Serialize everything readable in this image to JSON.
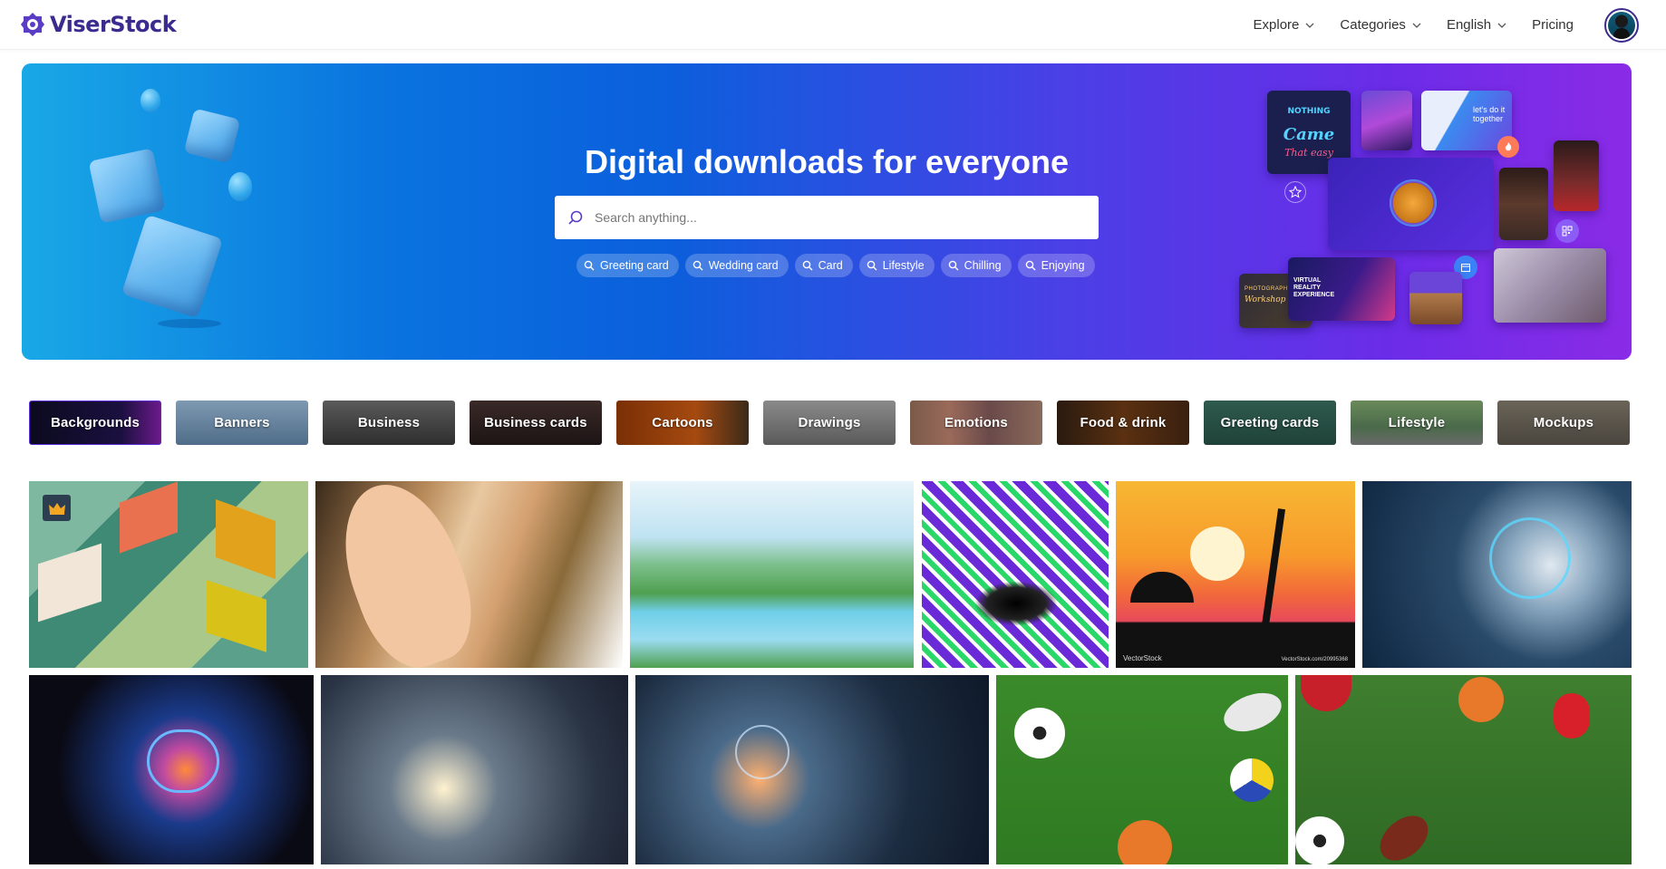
{
  "brand": {
    "name": "ViserStock",
    "accent": "#3b2b8e"
  },
  "nav": {
    "items": [
      {
        "label": "Explore",
        "has_dropdown": true
      },
      {
        "label": "Categories",
        "has_dropdown": true
      },
      {
        "label": "English",
        "has_dropdown": true
      },
      {
        "label": "Pricing",
        "has_dropdown": false
      }
    ]
  },
  "hero": {
    "title": "Digital downloads for everyone",
    "search": {
      "placeholder": "Search anything...",
      "value": ""
    },
    "tags": [
      "Greeting card",
      "Wedding card",
      "Card",
      "Lifestyle",
      "Chilling",
      "Enjoying"
    ],
    "collage": {
      "poster_lines": [
        "NOTHING",
        "Came",
        "That easy"
      ],
      "slide_text": "let's do it together",
      "vr_lines": [
        "VIRTUAL",
        "REALITY",
        "EXPERIENCE"
      ],
      "workshop_label": "PHOTOGRAPHY",
      "workshop_script": "Workshop"
    }
  },
  "categories": [
    "Backgrounds",
    "Banners",
    "Business",
    "Business cards",
    "Cartoons",
    "Drawings",
    "Emotions",
    "Food & drink",
    "Greeting cards",
    "Lifestyle",
    "Mockups"
  ],
  "gallery": {
    "row1": [
      "isometric-houses",
      "woman-portrait",
      "river-landscape",
      "optical-illusion",
      "beach-sunset",
      "tech-interface"
    ],
    "row2": [
      "ai-brain",
      "network-hands",
      "business-tech",
      "sports-equipment",
      "sports-balls"
    ],
    "watermark_left": "VectorStock",
    "watermark_right": "VectorStock.com/20995368"
  }
}
